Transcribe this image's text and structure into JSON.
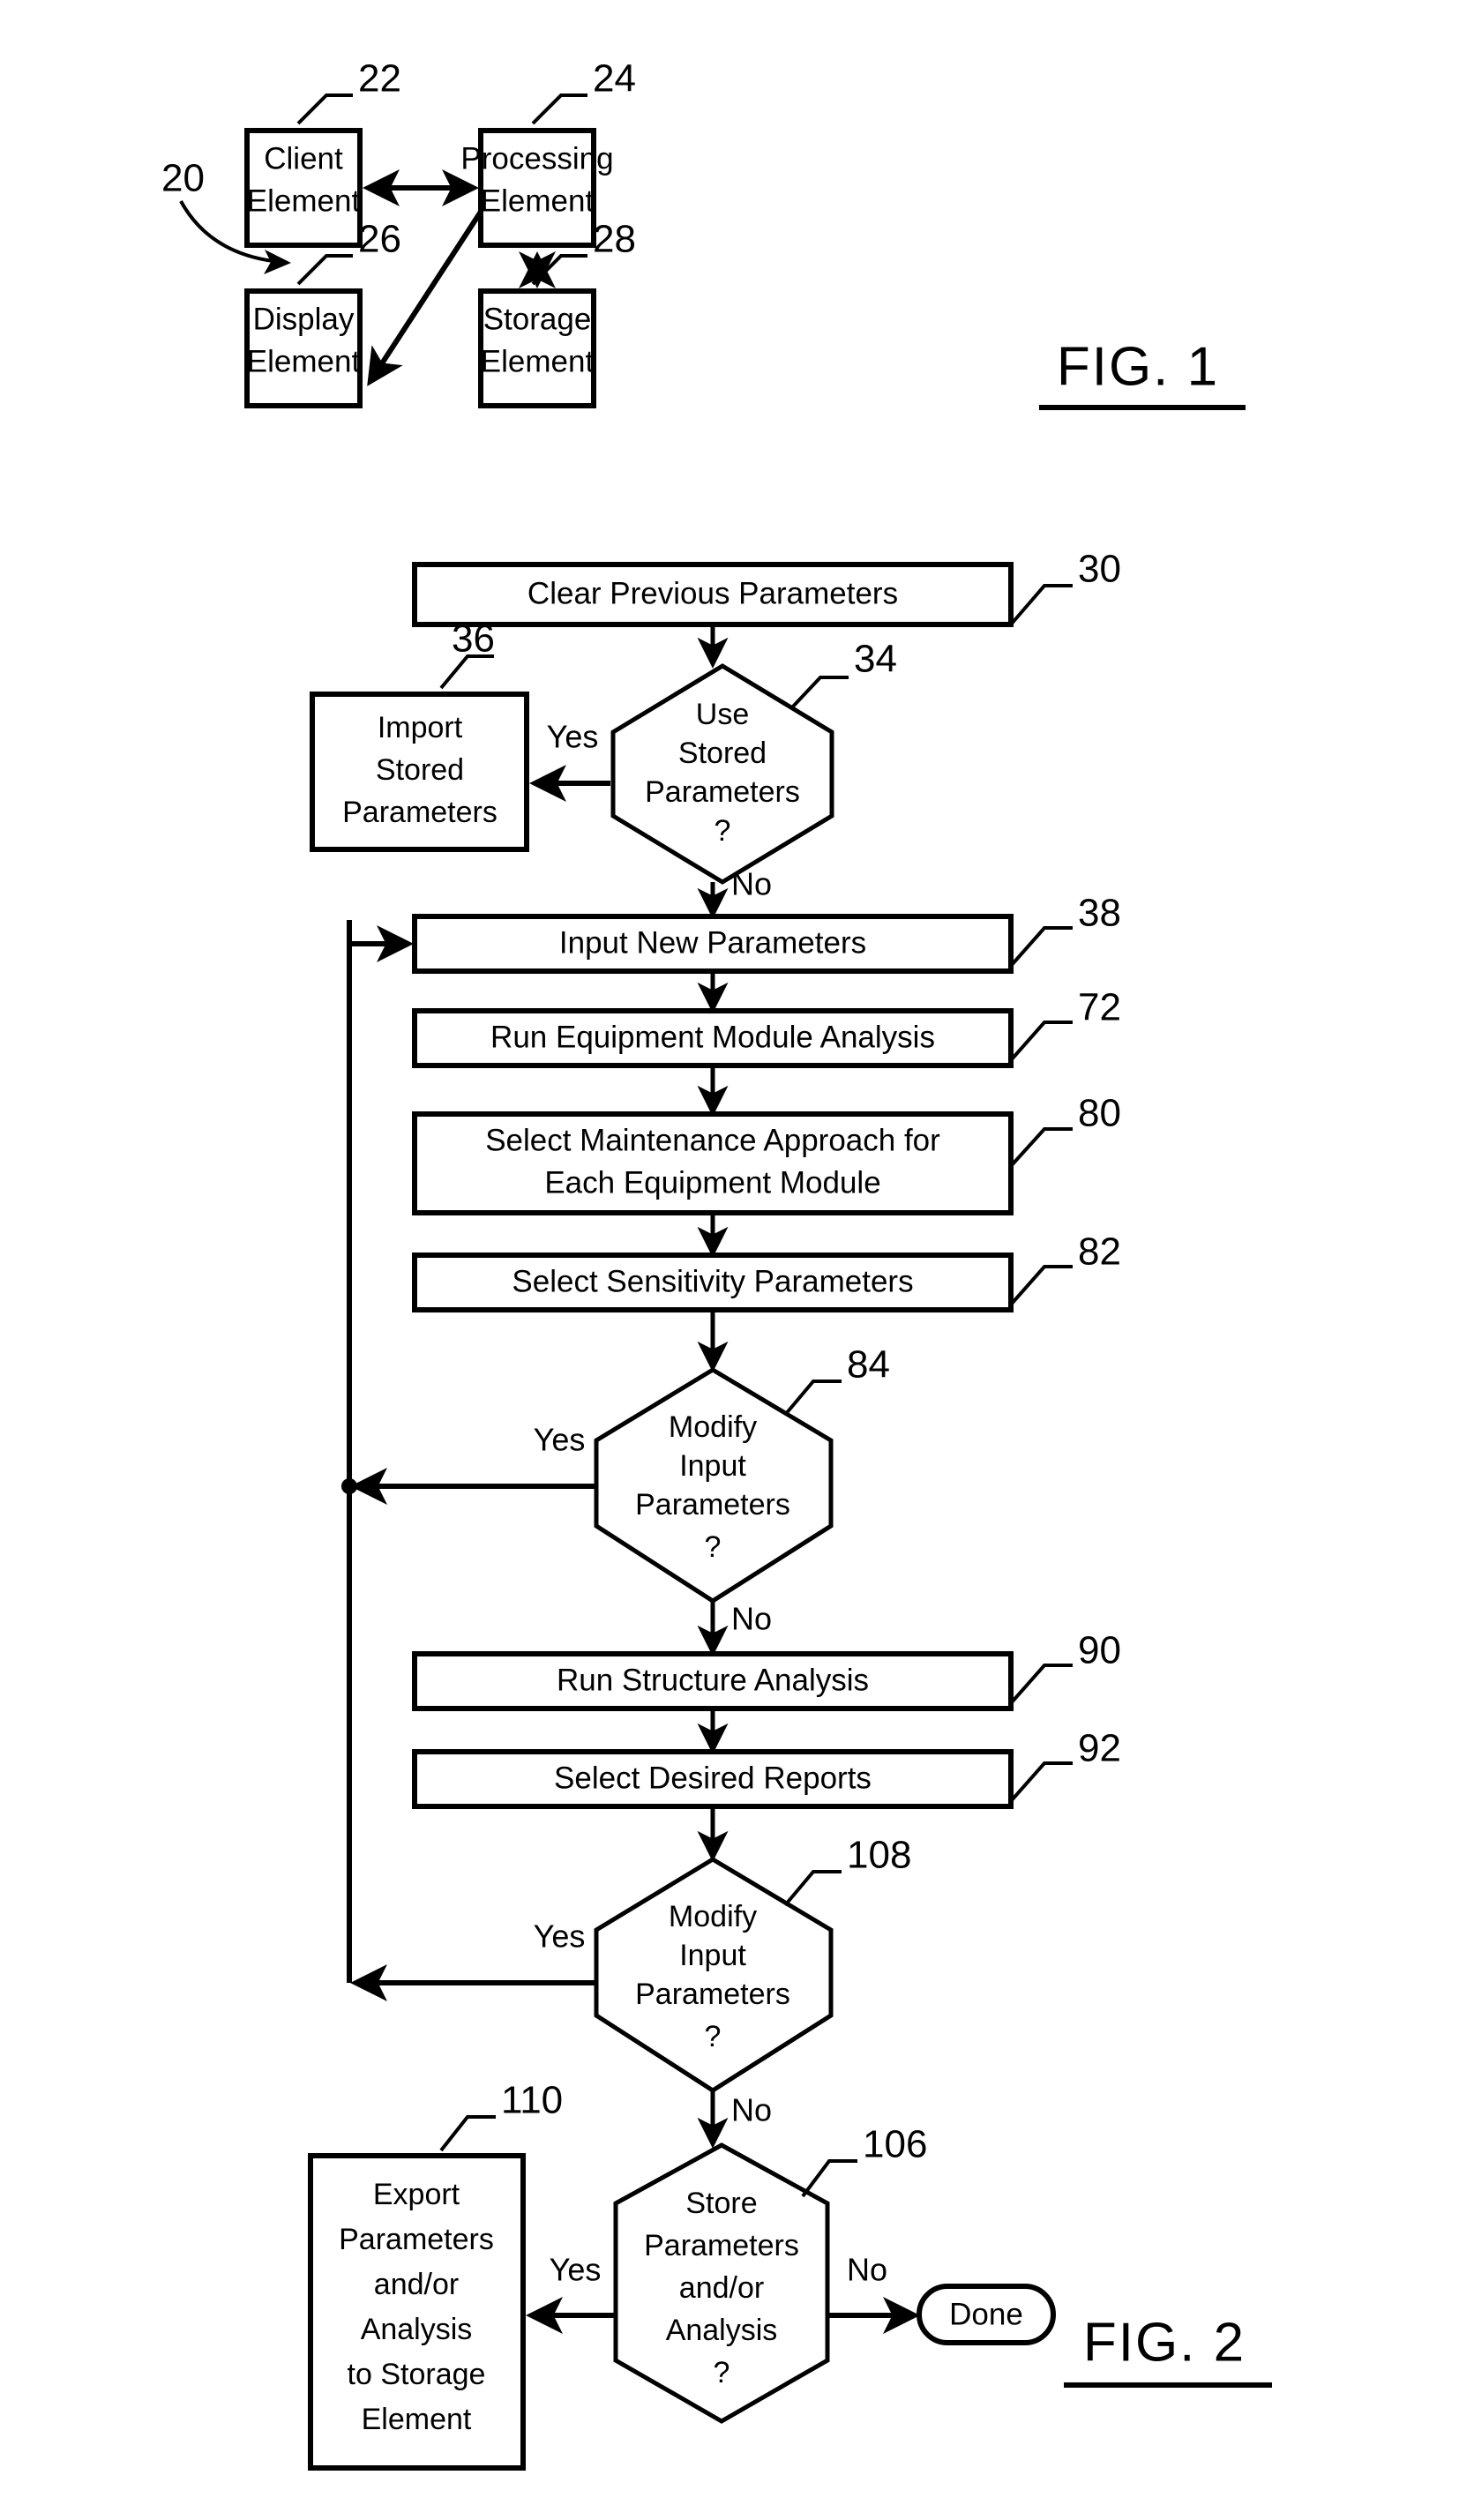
{
  "document": {
    "type": "patent-drawing-sheet",
    "background_color": "#ffffff",
    "ink_color": "#000000"
  },
  "figure1": {
    "label": "FIG. 1",
    "system_ref": "20",
    "nodes": [
      {
        "id": "client",
        "ref": "22",
        "lines": [
          "Client",
          "Element"
        ],
        "shape": "rect"
      },
      {
        "id": "processing",
        "ref": "24",
        "lines": [
          "Processing",
          "Element"
        ],
        "shape": "rect"
      },
      {
        "id": "display",
        "ref": "26",
        "lines": [
          "Display",
          "Element"
        ],
        "shape": "rect"
      },
      {
        "id": "storage",
        "ref": "28",
        "lines": [
          "Storage",
          "Element"
        ],
        "shape": "rect"
      }
    ],
    "connections": [
      {
        "from": "client",
        "to": "processing",
        "style": "bidirectional"
      },
      {
        "from": "processing",
        "to": "display",
        "style": "directed"
      },
      {
        "from": "processing",
        "to": "storage",
        "style": "bidirectional"
      }
    ]
  },
  "figure2": {
    "label": "FIG. 2",
    "nodes": [
      {
        "id": "n30",
        "ref": "30",
        "shape": "process",
        "lines": [
          "Clear Previous Parameters"
        ]
      },
      {
        "id": "n34",
        "ref": "34",
        "shape": "decision",
        "lines": [
          "Use",
          "Stored",
          "Parameters",
          "?"
        ]
      },
      {
        "id": "n36",
        "ref": "36",
        "shape": "process",
        "lines": [
          "Import",
          "Stored",
          "Parameters"
        ]
      },
      {
        "id": "n38",
        "ref": "38",
        "shape": "process",
        "lines": [
          "Input New Parameters"
        ]
      },
      {
        "id": "n72",
        "ref": "72",
        "shape": "process",
        "lines": [
          "Run Equipment Module Analysis"
        ]
      },
      {
        "id": "n80",
        "ref": "80",
        "shape": "process",
        "lines": [
          "Select Maintenance Approach for",
          "Each Equipment Module"
        ]
      },
      {
        "id": "n82",
        "ref": "82",
        "shape": "process",
        "lines": [
          "Select Sensitivity Parameters"
        ]
      },
      {
        "id": "n84",
        "ref": "84",
        "shape": "decision",
        "lines": [
          "Modify",
          "Input",
          "Parameters",
          "?"
        ]
      },
      {
        "id": "n90",
        "ref": "90",
        "shape": "process",
        "lines": [
          "Run Structure Analysis"
        ]
      },
      {
        "id": "n92",
        "ref": "92",
        "shape": "process",
        "lines": [
          "Select Desired Reports"
        ]
      },
      {
        "id": "n108",
        "ref": "108",
        "shape": "decision",
        "lines": [
          "Modify",
          "Input",
          "Parameters",
          "?"
        ]
      },
      {
        "id": "n106",
        "ref": "106",
        "shape": "decision",
        "lines": [
          "Store",
          "Parameters",
          "and/or",
          "Analysis",
          "?"
        ]
      },
      {
        "id": "n110",
        "ref": "110",
        "shape": "process",
        "lines": [
          "Export",
          "Parameters",
          "and/or",
          "Analysis",
          "to Storage",
          "Element"
        ]
      },
      {
        "id": "done",
        "ref": "",
        "shape": "terminator",
        "lines": [
          "Done"
        ]
      }
    ],
    "branch_labels": {
      "n34_yes": "Yes",
      "n34_no": "No",
      "n84_yes": "Yes",
      "n84_no": "No",
      "n108_yes": "Yes",
      "n108_no": "No",
      "n106_yes": "Yes",
      "n106_no": "No"
    },
    "edges": [
      {
        "from": "n30",
        "to": "n34",
        "label": ""
      },
      {
        "from": "n34",
        "to": "n36",
        "label": "Yes"
      },
      {
        "from": "n34",
        "to": "n38",
        "label": "No"
      },
      {
        "from": "n38",
        "to": "n72",
        "label": ""
      },
      {
        "from": "n72",
        "to": "n80",
        "label": ""
      },
      {
        "from": "n80",
        "to": "n82",
        "label": ""
      },
      {
        "from": "n82",
        "to": "n84",
        "label": ""
      },
      {
        "from": "n84",
        "to": "n38",
        "label": "Yes"
      },
      {
        "from": "n84",
        "to": "n90",
        "label": "No"
      },
      {
        "from": "n90",
        "to": "n92",
        "label": ""
      },
      {
        "from": "n92",
        "to": "n108",
        "label": ""
      },
      {
        "from": "n108",
        "to": "n38",
        "label": "Yes"
      },
      {
        "from": "n108",
        "to": "n106",
        "label": "No"
      },
      {
        "from": "n106",
        "to": "n110",
        "label": "Yes"
      },
      {
        "from": "n106",
        "to": "done",
        "label": "No"
      }
    ]
  }
}
